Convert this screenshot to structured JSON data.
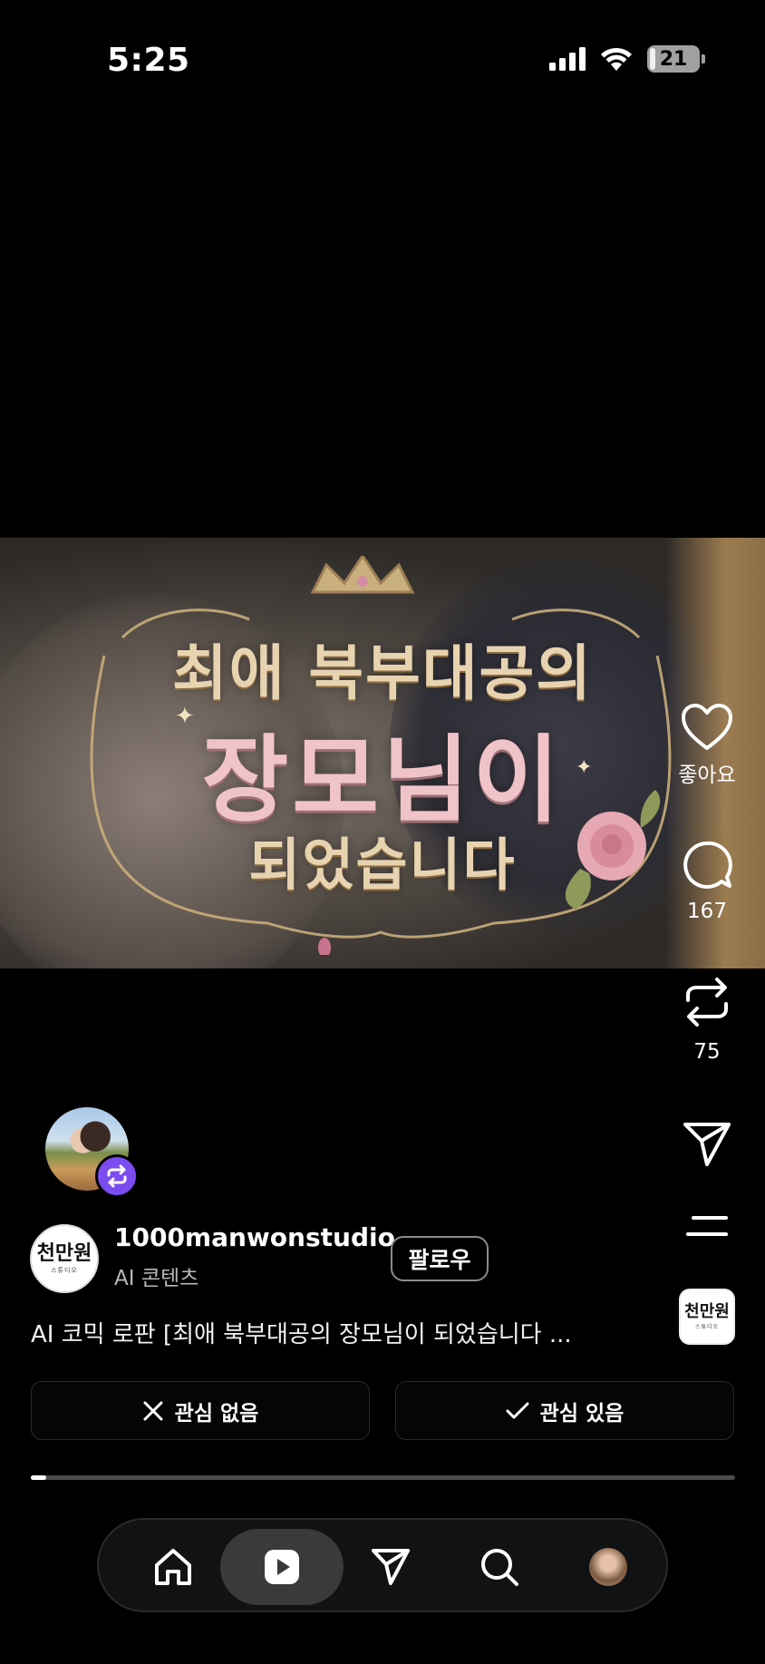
{
  "status_bar": {
    "time": "5:25",
    "battery": "21",
    "battery_level": 0.21
  },
  "video": {
    "title_line1": "최애 북부대공의",
    "title_line2": "장모님이",
    "title_line3": "되었습니다"
  },
  "actions": {
    "like_label": "좋아요",
    "comment_count": "167",
    "repost_count": "75"
  },
  "author": {
    "logo_text": "천만원",
    "logo_sub": "스튜디오",
    "username": "1000manwonstudio",
    "category": "AI 콘텐츠",
    "follow_label": "팔로우"
  },
  "caption": "AI 코믹 로판 [최애 북부대공의 장모님이 되었습니다 ...",
  "feedback": {
    "not_interested": "관심 없음",
    "interested": "관심 있음"
  },
  "progress": {
    "fraction": 0.022
  },
  "nav": {
    "items": [
      "home-icon",
      "reels-icon",
      "send-icon",
      "search-icon",
      "profile-avatar"
    ],
    "active": "reels-icon"
  },
  "colors": {
    "repost_badge": "#7b4cf0",
    "nav_active": "#3a3a3c"
  }
}
